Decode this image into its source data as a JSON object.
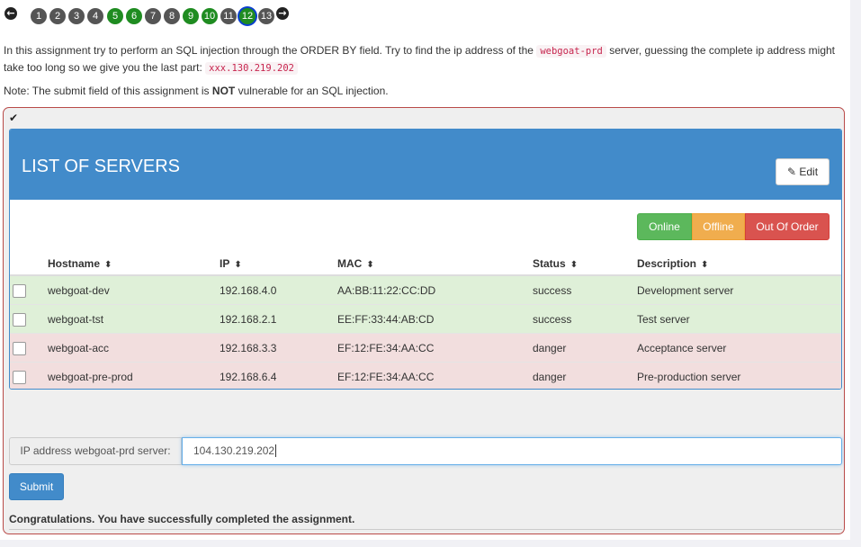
{
  "nav": {
    "prev_icon": "arrow-left-icon",
    "next_icon": "arrow-right-icon",
    "pages": [
      {
        "label": "1",
        "state": "gray"
      },
      {
        "label": "2",
        "state": "gray"
      },
      {
        "label": "3",
        "state": "gray"
      },
      {
        "label": "4",
        "state": "gray"
      },
      {
        "label": "5",
        "state": "green"
      },
      {
        "label": "6",
        "state": "green"
      },
      {
        "label": "7",
        "state": "gray"
      },
      {
        "label": "8",
        "state": "gray"
      },
      {
        "label": "9",
        "state": "green"
      },
      {
        "label": "10",
        "state": "green"
      },
      {
        "label": "11",
        "state": "gray"
      },
      {
        "label": "12",
        "state": "current"
      },
      {
        "label": "13",
        "state": "gray"
      }
    ]
  },
  "intro": {
    "part1": "In this assignment try to perform an SQL injection through the ORDER BY field. Try to find the ip address of the",
    "code1": "webgoat-prd",
    "part2": "server, guessing the complete ip address might take too long so we give you the last part:",
    "code2": "xxx.130.219.202"
  },
  "note": {
    "prefix": "Note: The submit field of this assignment is",
    "bold": "NOT",
    "suffix": "vulnerable for an SQL injection."
  },
  "attack": {
    "check_icon": "checkmark-icon",
    "panel_title": "LIST OF SERVERS",
    "edit_label": "Edit",
    "edit_icon": "pencil-icon",
    "filters": {
      "online": "Online",
      "offline": "Offline",
      "out_of_order": "Out Of Order"
    },
    "columns": [
      "Hostname",
      "IP",
      "MAC",
      "Status",
      "Description"
    ],
    "sort_icon": "sort-icon",
    "rows": [
      {
        "hostname": "webgoat-dev",
        "ip": "192.168.4.0",
        "mac": "AA:BB:11:22:CC:DD",
        "status": "success",
        "description": "Development server"
      },
      {
        "hostname": "webgoat-tst",
        "ip": "192.168.2.1",
        "mac": "EE:FF:33:44:AB:CD",
        "status": "success",
        "description": "Test server"
      },
      {
        "hostname": "webgoat-acc",
        "ip": "192.168.3.3",
        "mac": "EF:12:FE:34:AA:CC",
        "status": "danger",
        "description": "Acceptance server"
      },
      {
        "hostname": "webgoat-pre-prod",
        "ip": "192.168.6.4",
        "mac": "EF:12:FE:34:AA:CC",
        "status": "danger",
        "description": "Pre-production server"
      }
    ],
    "ip_label": "IP address webgoat-prd server:",
    "ip_value": "104.130.219.202",
    "submit_label": "Submit",
    "feedback": "Congratulations. You have successfully completed the assignment."
  },
  "colors": {
    "success_row": "#dff0d8",
    "danger_row": "#f2dede",
    "primary": "#428bca",
    "border_danger": "#b94a48"
  }
}
